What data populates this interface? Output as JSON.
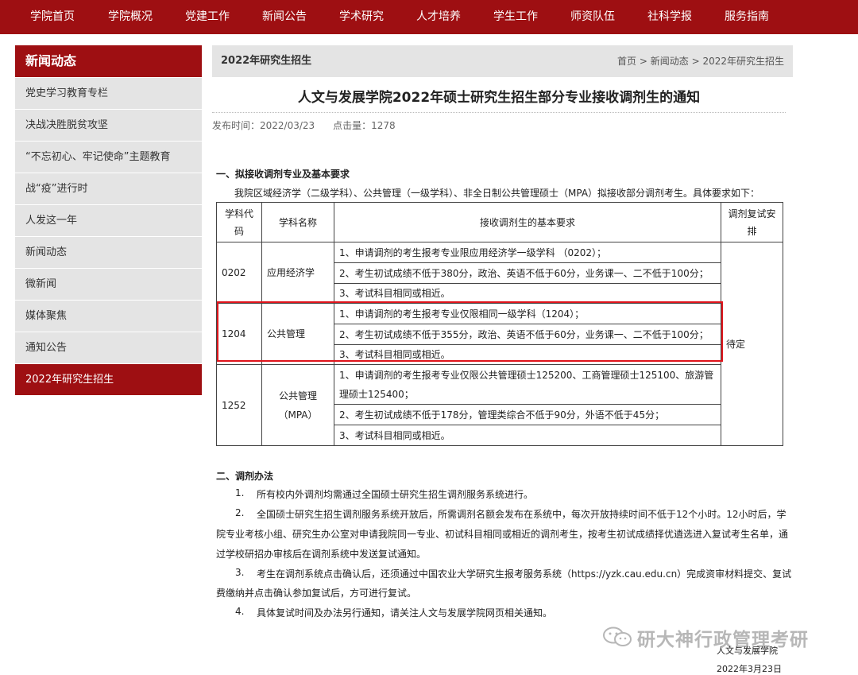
{
  "nav": [
    "学院首页",
    "学院概况",
    "党建工作",
    "新闻公告",
    "学术研究",
    "人才培养",
    "学生工作",
    "师资队伍",
    "社科学报",
    "服务指南"
  ],
  "sidebar": {
    "heading": "新闻动态",
    "items": [
      "党史学习教育专栏",
      "决战决胜脱贫攻坚",
      "“不忘初心、牢记使命”主题教育",
      "战“疫”进行时",
      "人发这一年",
      "新闻动态",
      "微新闻",
      "媒体聚焦",
      "通知公告",
      "2022年研究生招生"
    ],
    "active_index": 9
  },
  "breadcrumb_bar": {
    "title": "2022年研究生招生",
    "crumbs": [
      "首页",
      "新闻动态",
      "2022年研究生招生"
    ],
    "separator": ">"
  },
  "article": {
    "title": "人文与发展学院2022年硕士研究生招生部分专业接收调剂生的通知",
    "publish_label": "发布时间：",
    "publish_date": "2022/03/23",
    "clicks_label": "点击量：",
    "clicks": "1278",
    "section1_heading": "一、拟接收调剂专业及基本要求",
    "section1_intro": "我院区域经济学（二级学科）、公共管理（一级学科）、非全日制公共管理硕士（MPA）拟接收部分调剂考生。具体要求如下：",
    "section2_heading": "二、调剂办法",
    "section2_items": [
      {
        "num": "1.",
        "lines": [
          "所有校内外调剂均需通过全国硕士研究生招生调剂服务系统进行。"
        ]
      },
      {
        "num": "2.",
        "lines": [
          "全国硕士研究生招生调剂服务系统开放后，所需调剂名额会发布在系统中，每次开放持续时间不低于12个小时。12小时后，学",
          "院专业考核小组、研究生办公室对申请我院同一专业、初试科目相同或相近的调剂考生，按考生初试成绩择优遴选进入复试考生名单，通",
          "过学校研招办审核后在调剂系统中发送复试通知。"
        ]
      },
      {
        "num": "3.",
        "lines": [
          "考生在调剂系统点击确认后，还须通过中国农业大学研究生报考服务系统（https://yzk.cau.edu.cn）完成资审材料提交、复试",
          "费缴纳并点击确认参加复试后，方可进行复试。"
        ]
      },
      {
        "num": "4.",
        "lines": [
          "具体复试时间及办法另行通知，请关注人文与发展学院网页相关通知。"
        ]
      }
    ],
    "signature_org": "人文与发展学院",
    "signature_date": "2022年3月23日"
  },
  "table": {
    "headers": {
      "code": "学科代码",
      "name": "学科名称",
      "req": "接收调剂生的基本要求",
      "arrange": "调剂复试安排"
    },
    "rows": [
      {
        "code": "0202",
        "name": "应用经济学",
        "reqs": [
          "1、申请调剂的考生报考专业限应用经济学一级学科 （0202）；",
          "2、考生初试成绩不低于380分，政治、英语不低于60分，业务课一、二不低于100分；",
          "3、考试科目相同或相近。"
        ]
      },
      {
        "code": "1204",
        "name": "公共管理",
        "reqs": [
          "1、申请调剂的考生报考专业仅限相同一级学科（1204）；",
          "2、考生初试成绩不低于355分，政治、英语不低于60分，业务课一、二不低于100分；",
          "3、考试科目相同或相近。"
        ]
      },
      {
        "code": "1252",
        "name": "公共管理（MPA）",
        "reqs": [
          "1、申请调剂的考生报考专业仅限公共管理硕士125200、工商管理硕士125100、旅游管理硕士125400；",
          "2、考生初试成绩不低于178分，管理类综合不低于90分，外语不低于45分；",
          "3、考试科目相同或相近。"
        ]
      }
    ],
    "arrange_value": "待定"
  },
  "watermark": "研大神行政管理考研",
  "colors": {
    "brand": "#9e0f12",
    "highlight": "#e0141b",
    "sidebar_bg": "#e4e4e4"
  }
}
